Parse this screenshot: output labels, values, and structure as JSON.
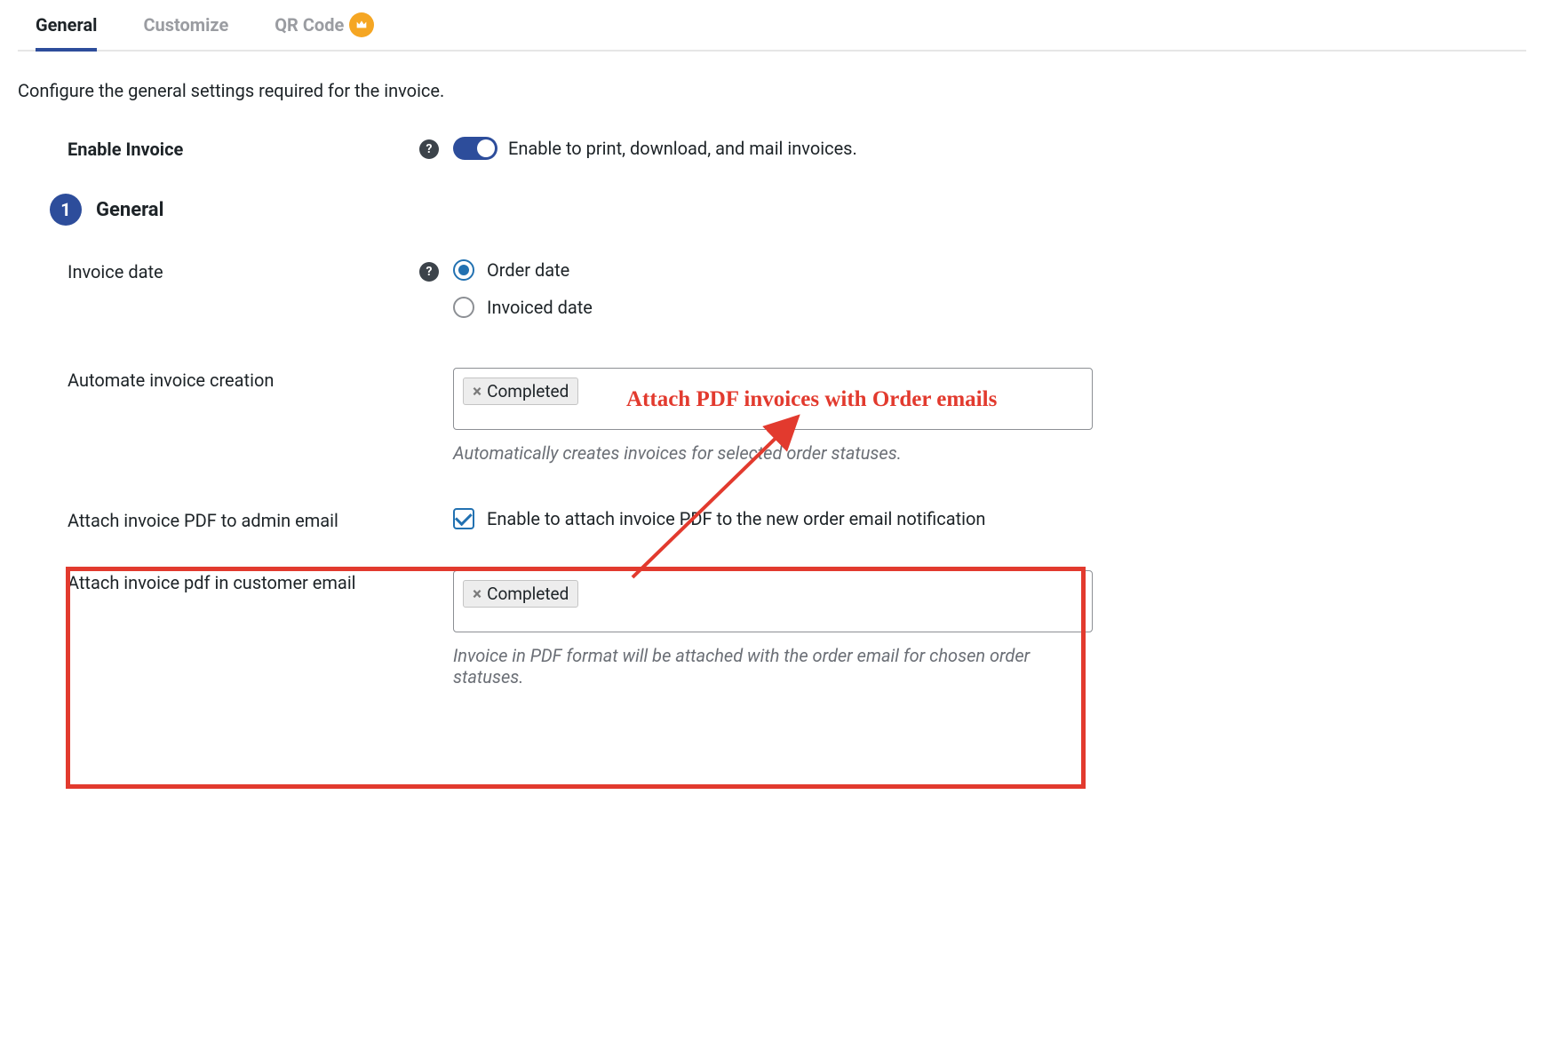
{
  "tabs": {
    "general": "General",
    "customize": "Customize",
    "qrcode": "QR Code"
  },
  "intro": "Configure the general settings required for the invoice.",
  "enable": {
    "label": "Enable Invoice",
    "desc": "Enable to print, download, and mail invoices."
  },
  "section": {
    "num": "1",
    "title": "General"
  },
  "invoiceDate": {
    "label": "Invoice date",
    "opt1": "Order date",
    "opt2": "Invoiced date"
  },
  "automate": {
    "label": "Automate invoice creation",
    "tag": "Completed",
    "hint": "Automatically creates invoices for selected order statuses."
  },
  "adminEmail": {
    "label": "Attach invoice PDF to admin email",
    "desc": "Enable to attach invoice PDF to the new order email notification"
  },
  "customerEmail": {
    "label": "Attach invoice pdf in customer email",
    "tag": "Completed",
    "hint": "Invoice in PDF format will be attached with the order email for chosen order statuses."
  },
  "annotation": {
    "text": "Attach PDF invoices with Order emails"
  }
}
